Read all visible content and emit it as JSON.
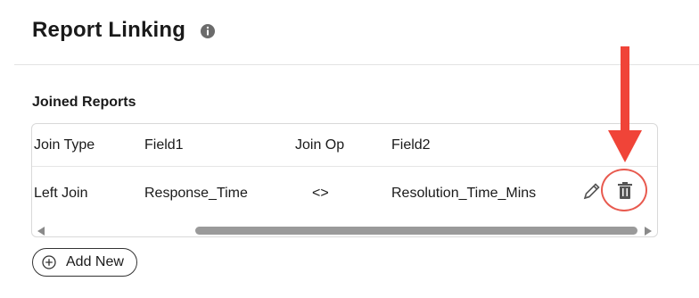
{
  "header": {
    "title": "Report Linking",
    "info_icon": "info-circle-icon"
  },
  "section": {
    "label": "Joined Reports"
  },
  "table": {
    "columns": [
      "Join Type",
      "Field1",
      "Join Op",
      "Field2"
    ],
    "rows": [
      {
        "join_type": "Left Join",
        "field1": "Response_Time",
        "join_op": "<>",
        "field2": "Resolution_Time_Mins"
      }
    ],
    "row_actions": [
      "edit-icon",
      "trash-icon"
    ]
  },
  "actions": {
    "add_new_label": "Add New"
  },
  "colors": {
    "highlight": "#e85a4f",
    "arrow": "#f04438",
    "text": "#1a1a1a"
  }
}
